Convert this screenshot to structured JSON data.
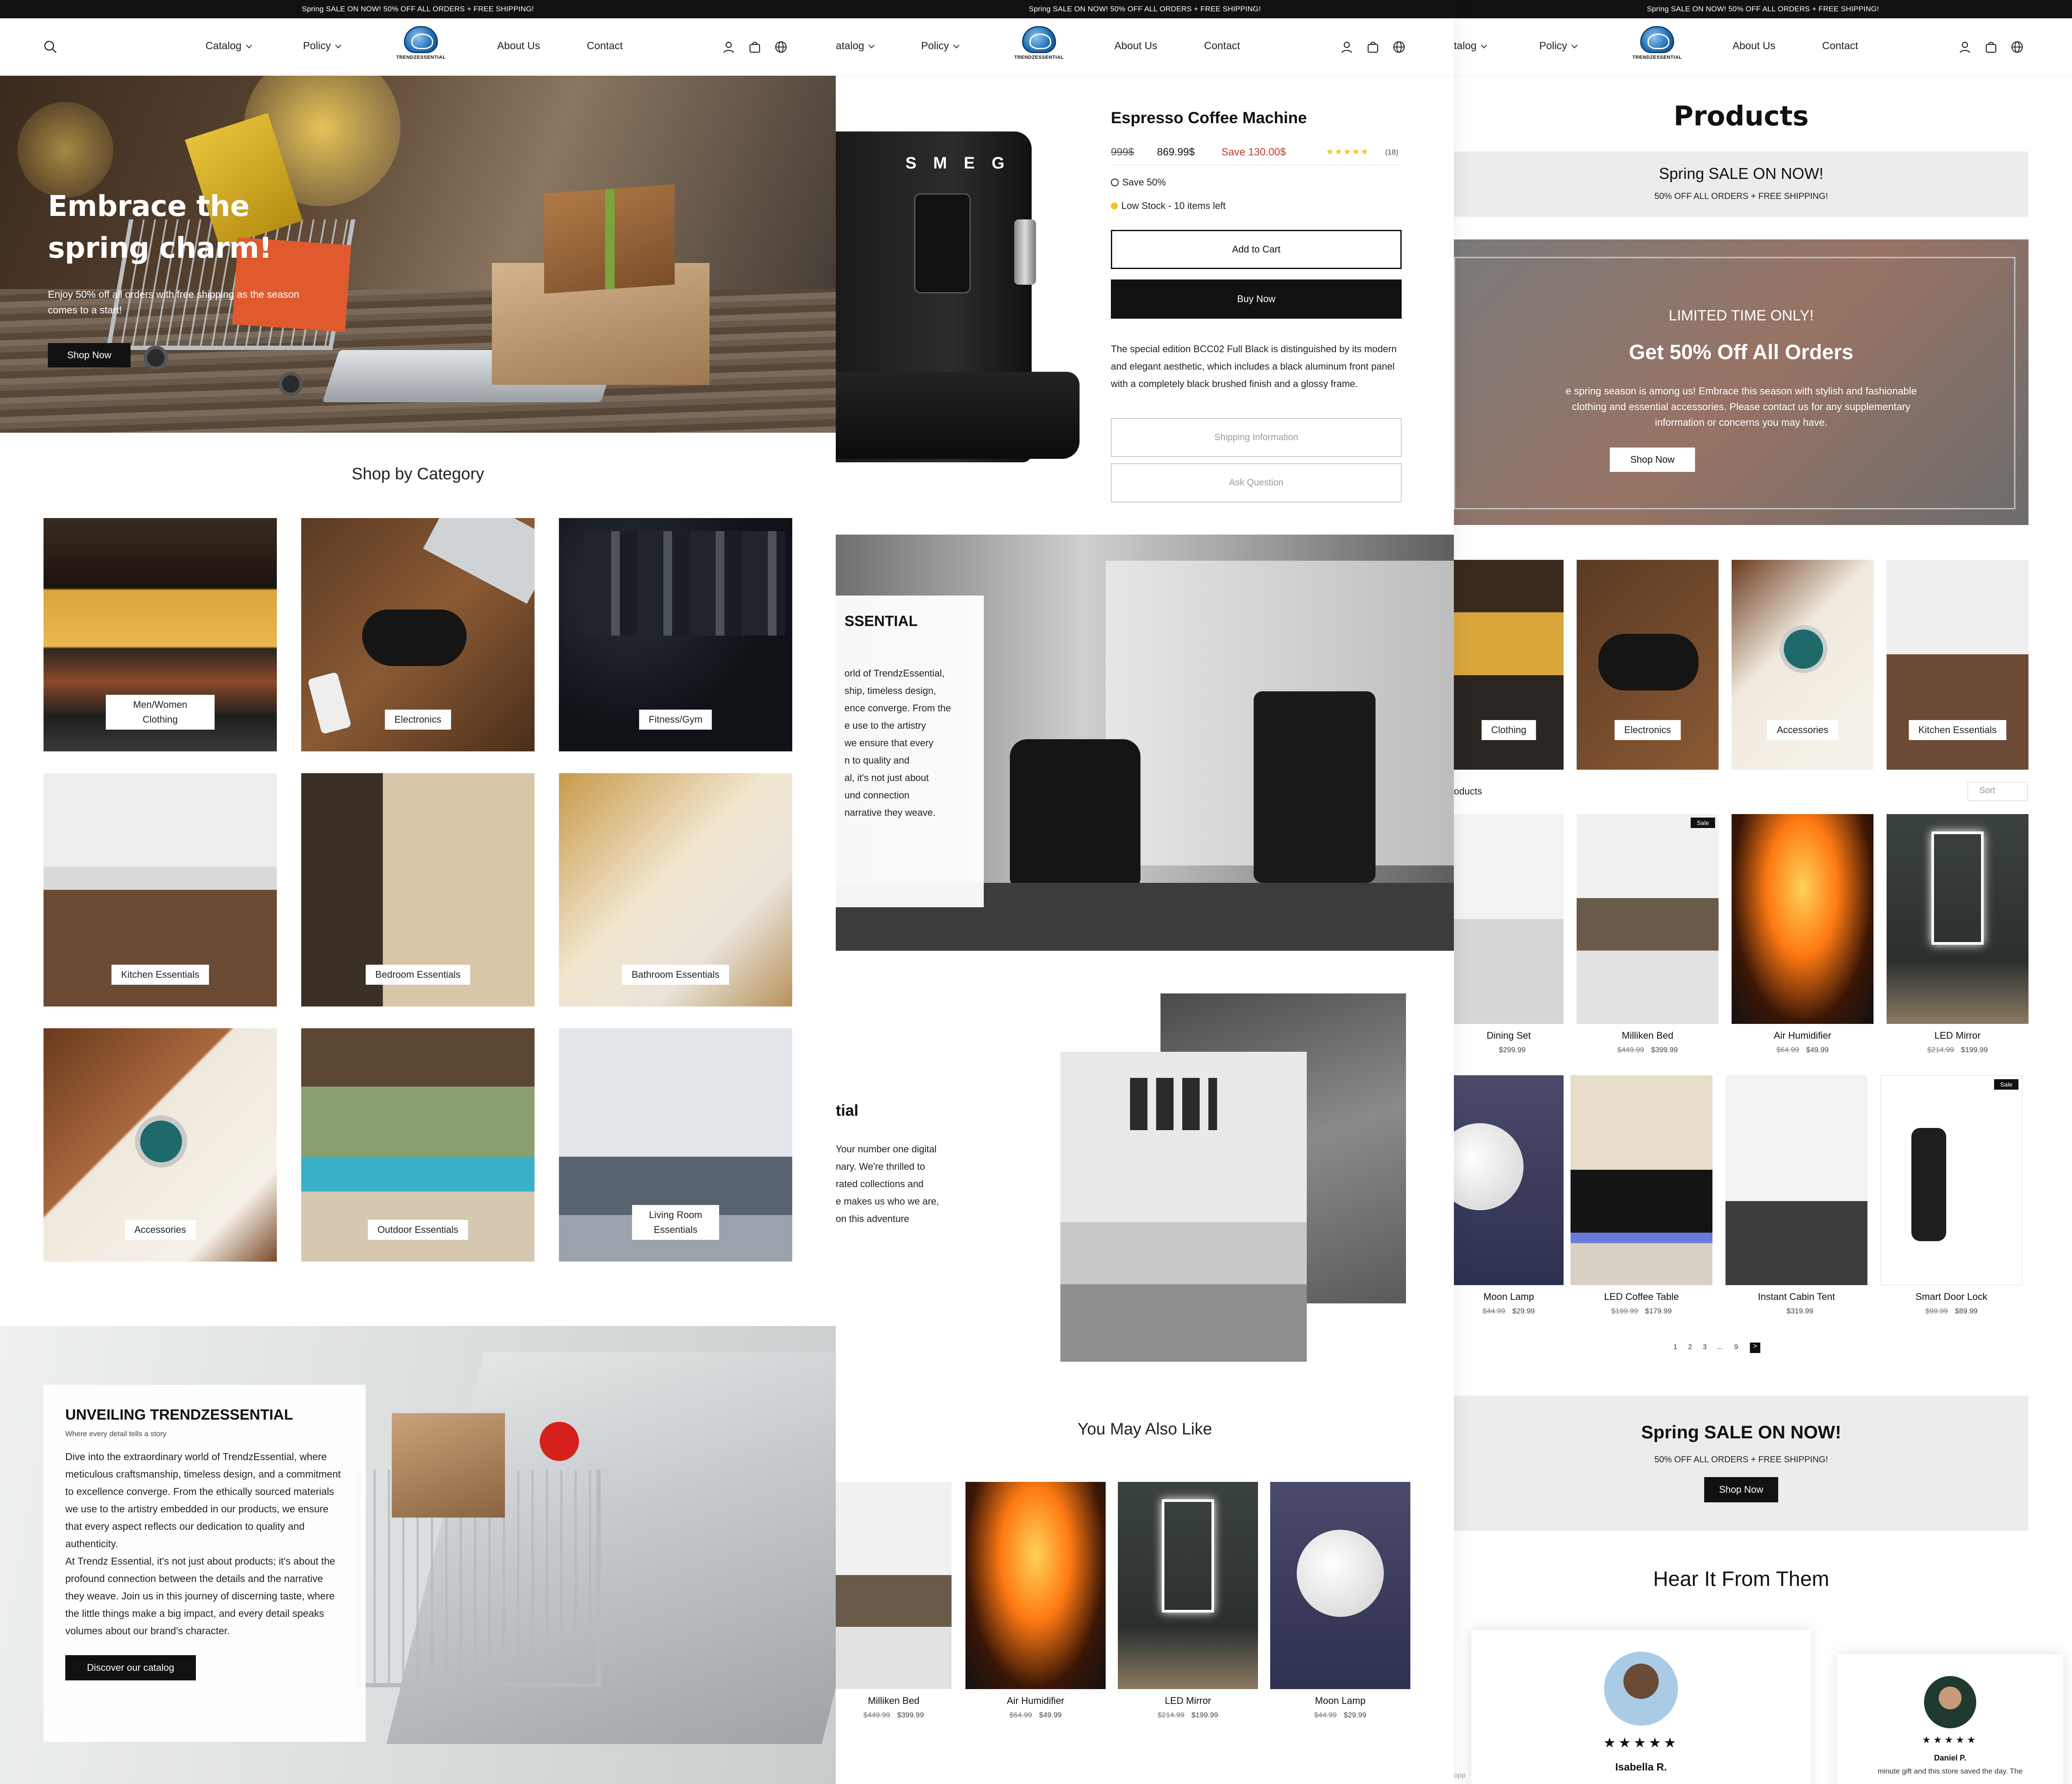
{
  "promo_text": "Spring SALE ON NOW! 50% OFF ALL ORDERS + FREE SHIPPING!",
  "nav": {
    "catalog": "Catalog",
    "catalog_cut": "atalog",
    "catalog_cut2": "talog",
    "policy": "Policy",
    "about": "About Us",
    "contact": "Contact",
    "logo_text": "TRENDZESSENTIAL"
  },
  "home": {
    "hero_title_1": "Embrace the",
    "hero_title_2": "spring charm!",
    "hero_sub": "Enjoy 50% off all orders with free shipping as the season comes to a start!",
    "hero_button": "Shop Now",
    "category_title": "Shop by Category",
    "categories": [
      {
        "label": "Men/Women Clothing"
      },
      {
        "label": "Electronics"
      },
      {
        "label": "Fitness/Gym"
      },
      {
        "label": "Kitchen Essentials"
      },
      {
        "label": "Bedroom Essentials"
      },
      {
        "label": "Bathroom Essentials"
      },
      {
        "label": "Accessories"
      },
      {
        "label": "Outdoor Essentials"
      },
      {
        "label": "Living Room Essentials"
      }
    ],
    "about_title": "UNVEILING TRENDZESSENTIAL",
    "about_sub": "Where every detail tells a story",
    "about_text_1": "Dive into the extraordinary world of TrendzEssential, where meticulous craftsmanship, timeless design, and a commitment to excellence converge. From the ethically sourced materials we use to the artistry embedded in our products, we ensure that every aspect reflects our dedication to quality and authenticity.",
    "about_text_2": "At Trendz Essential, it's not just about products; it's about the profound connection between the details and the narrative they weave. Join us in this journey of discerning taste, where the little things make a big impact, and every detail speaks volumes about our brand's character.",
    "about_button": "Discover our catalog"
  },
  "product": {
    "title": "Espresso Coffee Machine",
    "old_price": "999$",
    "price": "869.99$",
    "save_text": "Save 130.00$",
    "rating_count": "(18)",
    "save_pct": "Save 50%",
    "stock": "Low Stock - 10 items left",
    "add_to_cart": "Add to Cart",
    "buy_now": "Buy Now",
    "description": "The special edition BCC02 Full Black is distinguished by its modern and elegant aesthetic, which includes a black aluminum front panel with a completely black brushed finish and a glossy frame.",
    "shipping_info": "Shipping Information",
    "ask_question": "Ask Question",
    "machine_brand": "S M E G",
    "band_title": "SSENTIAL",
    "band_lines": [
      "orld of TrendzEssential,",
      "ship, timeless design,",
      "ence converge. From the",
      "e use to the artistry",
      "we ensure that every",
      "n to quality and",
      "al, it's not just about",
      "und connection",
      "narrative they weave."
    ],
    "mid_title": "tial",
    "mid_lines": [
      "Your number one digital",
      "nary. We're thrilled to",
      "rated collections and",
      "e makes us who we are,",
      "on this adventure"
    ],
    "also_like_title": "You May Also Like",
    "also_like": [
      {
        "name": "Milliken Bed",
        "old": "$449.99",
        "price": "$399.99"
      },
      {
        "name": "Air Humidifier",
        "old": "$64.99",
        "price": "$49.99"
      },
      {
        "name": "LED Mirror",
        "old": "$214.99",
        "price": "$199.99"
      },
      {
        "name": "Moon Lamp",
        "old": "$44.99",
        "price": "$29.99"
      }
    ]
  },
  "products": {
    "title": "Products",
    "sale_title": "Spring SALE ON NOW!",
    "sale_sub": "50% OFF ALL ORDERS + FREE SHIPPING!",
    "banner_kicker": "LIMITED TIME ONLY!",
    "banner_title": "Get 50% Off All Orders",
    "banner_text_1": "e spring season is among us! Embrace this season with stylish and fashionable",
    "banner_text_2": "clothing and essential accessories. Please contact us for any supplementary",
    "banner_text_3": "information or concerns you may have.",
    "banner_button": "Shop Now",
    "cats": [
      {
        "label": "Clothing"
      },
      {
        "label": "Electronics"
      },
      {
        "label": "Accessories"
      },
      {
        "label": "Kitchen Essentials"
      }
    ],
    "list_label": "oducts",
    "sort_label": "Sort",
    "sale_badge": "Sale",
    "items": [
      {
        "name": "Dining Set",
        "old": "",
        "price": "$299.99"
      },
      {
        "name": "Milliken Bed",
        "old": "$449.99",
        "price": "$399.99"
      },
      {
        "name": "Air Humidifier",
        "old": "$64.99",
        "price": "$49.99"
      },
      {
        "name": "LED Mirror",
        "old": "$214.99",
        "price": "$199.99"
      },
      {
        "name": "Moon Lamp",
        "old": "$44.99",
        "price": "$29.99"
      },
      {
        "name": "LED Coffee Table",
        "old": "$199.99",
        "price": "$179.99"
      },
      {
        "name": "Instant Cabin Tent",
        "old": "",
        "price": "$319.99"
      },
      {
        "name": "Smart Door Lock",
        "old": "$99.99",
        "price": "$89.99"
      }
    ],
    "pages": [
      "1",
      "2",
      "3",
      "...",
      "9",
      ">"
    ],
    "footer_sale_title": "Spring SALE ON NOW!",
    "footer_sale_sub": "50% OFF ALL ORDERS + FREE SHIPPING!",
    "footer_button": "Shop Now",
    "reviews_title": "Hear It From Them",
    "review_1_name": "Isabella R.",
    "review_2_name": "Daniel P.",
    "review_2_text": "minute gift and this store saved the day. The",
    "review_left_cut": "opp",
    "stars": "★★★★★"
  },
  "colors": {
    "accent_red": "#c0392b",
    "star_gold": "#f5c518",
    "dark": "#111111"
  }
}
